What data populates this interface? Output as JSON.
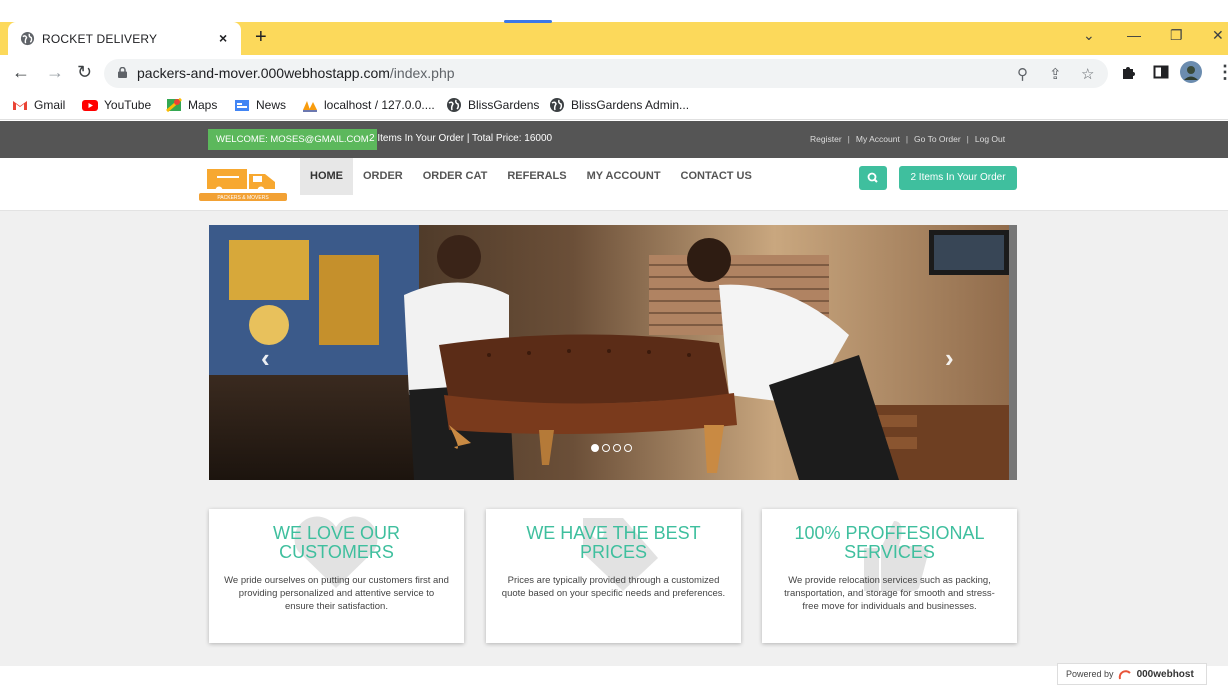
{
  "browser": {
    "tab_title": "ROCKET DELIVERY",
    "tab_close": "×",
    "new_tab": "+",
    "url_host": "packers-and-mover.000webhostapp.com",
    "url_path": "/index.php",
    "bookmarks": [
      {
        "label": "Gmail",
        "icon": "gmail-icon"
      },
      {
        "label": "YouTube",
        "icon": "youtube-icon"
      },
      {
        "label": "Maps",
        "icon": "maps-icon"
      },
      {
        "label": "News",
        "icon": "news-icon"
      },
      {
        "label": "localhost / 127.0.0....",
        "icon": "phpmyadmin-icon"
      },
      {
        "label": "BlissGardens",
        "icon": "globe-icon"
      },
      {
        "label": "BlissGardens Admin...",
        "icon": "globe-icon"
      }
    ],
    "accent": "#fcd95b"
  },
  "site": {
    "welcome": "WELCOME: MOSES@GMAIL.COM",
    "order_summary": "2 Items In Your Order | Total Price: 16000",
    "top_links": [
      "Register",
      "My Account",
      "Go To Order",
      "Log Out"
    ],
    "logo_text": "PACKERS & MOVERS",
    "menu": [
      "HOME",
      "ORDER",
      "ORDER CAT",
      "REFERALS",
      "MY ACCOUNT",
      "CONTACT US"
    ],
    "cart_button": "2 Items In Your Order",
    "carousel": {
      "prev": "‹",
      "next": "›",
      "slides": 4,
      "active": 1
    },
    "cards": [
      {
        "title": "WE LOVE OUR CUSTOMERS",
        "text": "We pride ourselves on putting our customers first and providing personalized and attentive service to ensure their satisfaction."
      },
      {
        "title": "WE HAVE THE BEST PRICES",
        "text": "Prices are typically provided through a customized quote based on your specific needs and preferences."
      },
      {
        "title": "100% PROFFESIONAL SERVICES",
        "text": "We provide relocation services such as packing, transportation, and storage for smooth and stress-free move for individuals and businesses."
      }
    ],
    "powered_by": "Powered by",
    "host_brand": "000webhost",
    "accent": "#3fbf9e"
  }
}
